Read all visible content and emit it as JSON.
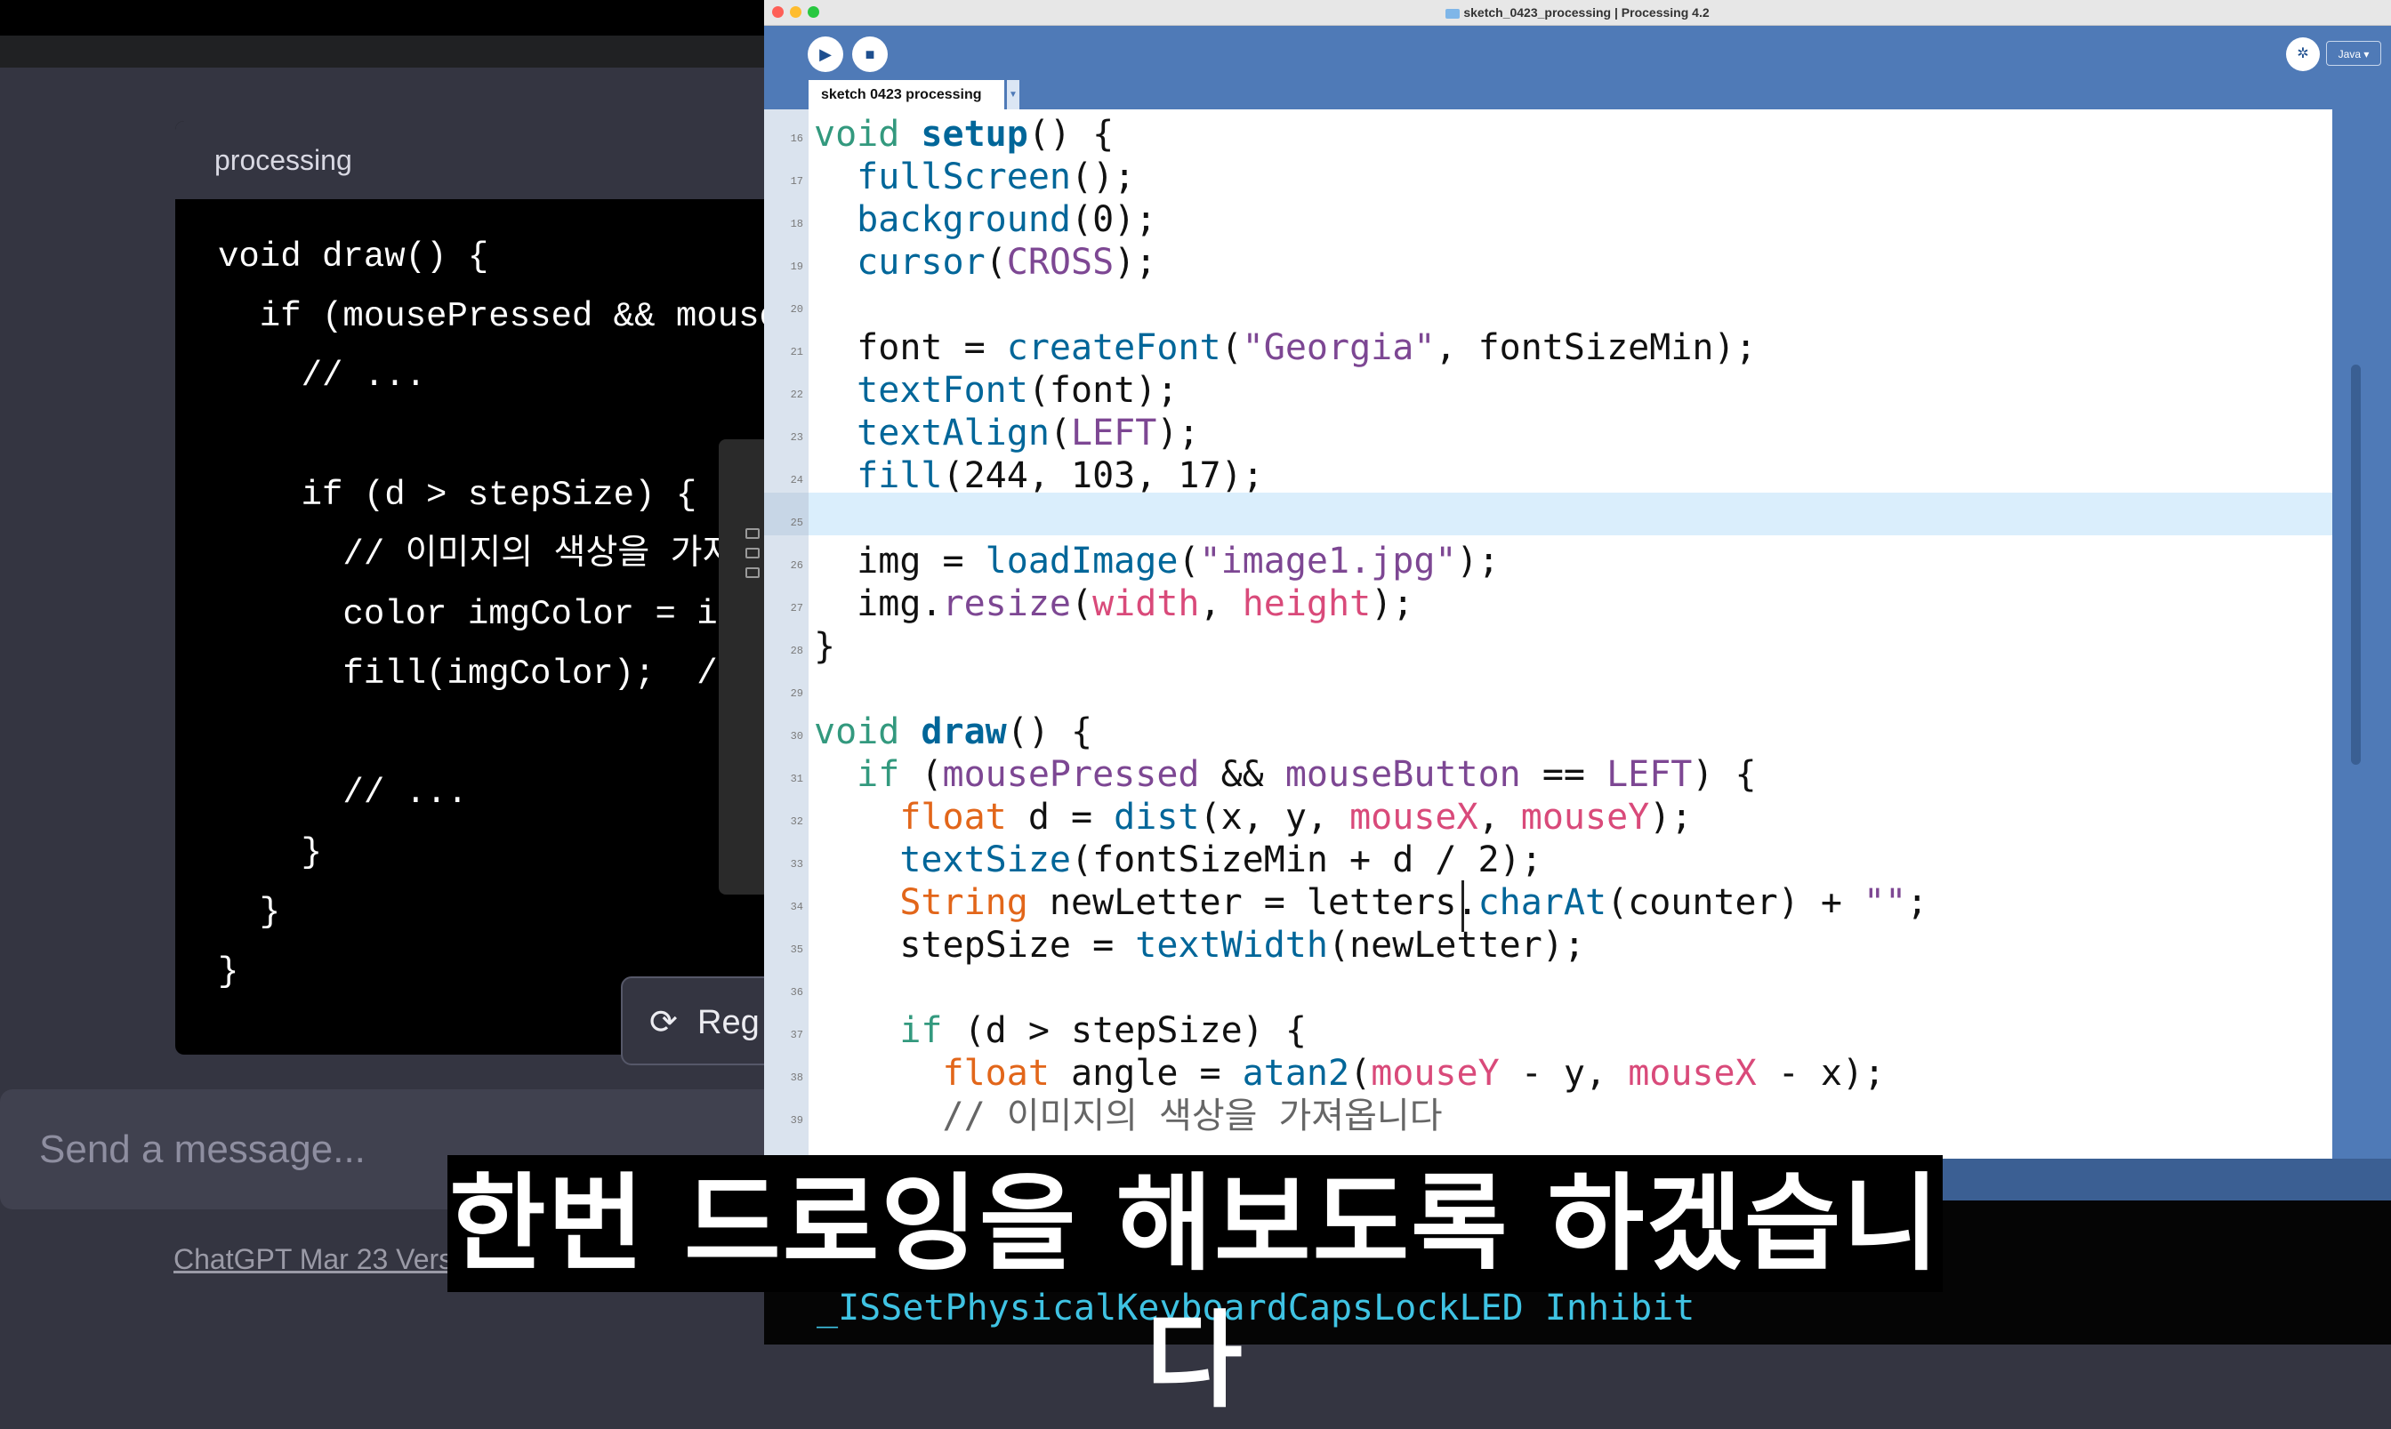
{
  "chatgpt": {
    "code_card_language": "processing",
    "code_lines": [
      "void draw() {",
      "  if (mousePressed && mouse",
      "    // ...",
      "",
      "    if (d > stepSize) {",
      "      // 이미지의 색상을 가져",
      "      color imgColor = im",
      "      fill(imgColor);  //",
      "",
      "      // ...",
      "    }",
      "  }",
      "}"
    ],
    "regenerate_label": "Reg",
    "message_placeholder": "Send a message...",
    "footer_link": "ChatGPT Mar 23 Vers"
  },
  "processing": {
    "window_title": "sketch_0423_processing | Processing 4.2",
    "run_icon": "play-icon",
    "stop_icon": "stop-icon",
    "mode_label": "Java ▾",
    "tab_label": "sketch 0423 processing",
    "line_numbers": [
      "16",
      "17",
      "18",
      "19",
      "20",
      "21",
      "22",
      "23",
      "24",
      "25",
      "26",
      "27",
      "28",
      "29",
      "30",
      "31",
      "32",
      "33",
      "34",
      "35",
      "36",
      "37",
      "38",
      "39"
    ],
    "code": {
      "l16": {
        "a": "void",
        "b": "setup",
        "c": "() {"
      },
      "l17": {
        "a": "  ",
        "b": "fullScreen",
        "c": "();"
      },
      "l18": {
        "a": "  ",
        "b": "background",
        "c": "(0);"
      },
      "l19": {
        "a": "  ",
        "b": "cursor",
        "c": "(",
        "d": "CROSS",
        "e": ");"
      },
      "l21": {
        "a": "  font = ",
        "b": "createFont",
        "c": "(",
        "d": "\"Georgia\"",
        "e": ", fontSizeMin);"
      },
      "l22": {
        "a": "  ",
        "b": "textFont",
        "c": "(font);"
      },
      "l23": {
        "a": "  ",
        "b": "textAlign",
        "c": "(",
        "d": "LEFT",
        "e": ");"
      },
      "l24": {
        "a": "  ",
        "b": "fill",
        "c": "(244, 103, 17);"
      },
      "l26": {
        "a": "  img = ",
        "b": "loadImage",
        "c": "(",
        "d": "\"image1.jpg\"",
        "e": ");"
      },
      "l27": {
        "a": "  img.",
        "b": "resize",
        "c": "(",
        "d": "width",
        "e": ", ",
        "f": "height",
        "g": ");"
      },
      "l28": {
        "a": "}"
      },
      "l30": {
        "a": "void",
        "b": "draw",
        "c": "() {"
      },
      "l31": {
        "a": "  ",
        "b": "if",
        "c": " (",
        "d": "mousePressed",
        "e": " && ",
        "f": "mouseButton",
        "g": " == ",
        "h": "LEFT",
        "i": ") {"
      },
      "l32": {
        "a": "    ",
        "b": "float",
        "c": " d = ",
        "d": "dist",
        "e": "(x, y, ",
        "f": "mouseX",
        "g": ", ",
        "h": "mouseY",
        "i": ");"
      },
      "l33": {
        "a": "    ",
        "b": "textSize",
        "c": "(fontSizeMin + d / 2);"
      },
      "l34": {
        "a": "    ",
        "b": "String",
        "c": " newLetter = letters.",
        "d": "charAt",
        "e": "(counter) + ",
        "f": "\"\"",
        "g": ";"
      },
      "l35": {
        "a": "    stepSize = ",
        "b": "textWidth",
        "c": "(newLetter);"
      },
      "l37": {
        "a": "    ",
        "b": "if",
        "c": " (d > stepSize) {"
      },
      "l38": {
        "a": "      ",
        "b": "float",
        "c": " angle = ",
        "d": "atan2",
        "e": "(",
        "f": "mouseY",
        "g": " - y, ",
        "h": "mouseX",
        "i": " - x);"
      },
      "l39": {
        "a": "      // 이미지의 색상을 가져옵니다"
      }
    },
    "console_text": "_ISSetPhysicalKeyboardCapsLockLED Inhibit"
  },
  "subtitle": "한번 드로잉을 해보도록 하겠습니다",
  "colors": {
    "processing_blue": "#4f7ab7",
    "keyword_green": "#33997e",
    "type_orange": "#e2661a",
    "function_blue": "#006699",
    "variable_pink": "#d94a7a",
    "constant_purple": "#7d4793",
    "current_line": "#daeefc"
  }
}
